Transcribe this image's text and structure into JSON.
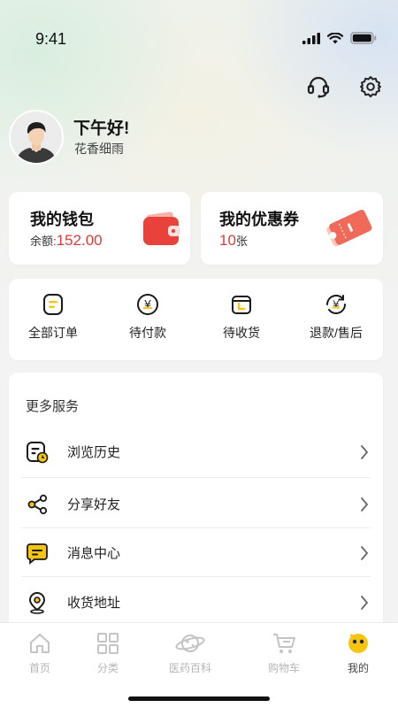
{
  "status_bar": {
    "time": "9:41"
  },
  "profile": {
    "greeting": "下午好!",
    "username": "花香细雨"
  },
  "wallet": {
    "title": "我的钱包",
    "balance_label": "余额:",
    "balance_value": "152.00"
  },
  "coupons": {
    "title": "我的优惠券",
    "count": "10",
    "unit": "张"
  },
  "orders": {
    "items": [
      {
        "label": "全部订单",
        "icon": "order-list-icon"
      },
      {
        "label": "待付款",
        "icon": "yuan-coin-icon"
      },
      {
        "label": "待收货",
        "icon": "package-icon"
      },
      {
        "label": "退款/售后",
        "icon": "refund-icon"
      }
    ]
  },
  "services": {
    "title": "更多服务",
    "items": [
      {
        "label": "浏览历史",
        "icon": "history-icon"
      },
      {
        "label": "分享好友",
        "icon": "share-icon"
      },
      {
        "label": "消息中心",
        "icon": "message-icon"
      },
      {
        "label": "收货地址",
        "icon": "location-icon"
      }
    ]
  },
  "tabbar": {
    "items": [
      {
        "label": "首页",
        "icon": "home-icon",
        "active": false
      },
      {
        "label": "分类",
        "icon": "category-icon",
        "active": false
      },
      {
        "label": "医药百科",
        "icon": "planet-icon",
        "active": false
      },
      {
        "label": "购物车",
        "icon": "cart-icon",
        "active": false
      },
      {
        "label": "我的",
        "icon": "mine-face-icon",
        "active": true
      }
    ]
  },
  "colors": {
    "accent_yellow": "#f6c511",
    "price_red": "#e23b36",
    "wallet_red": "#e8423a",
    "coupon_red": "#f06a5a"
  }
}
